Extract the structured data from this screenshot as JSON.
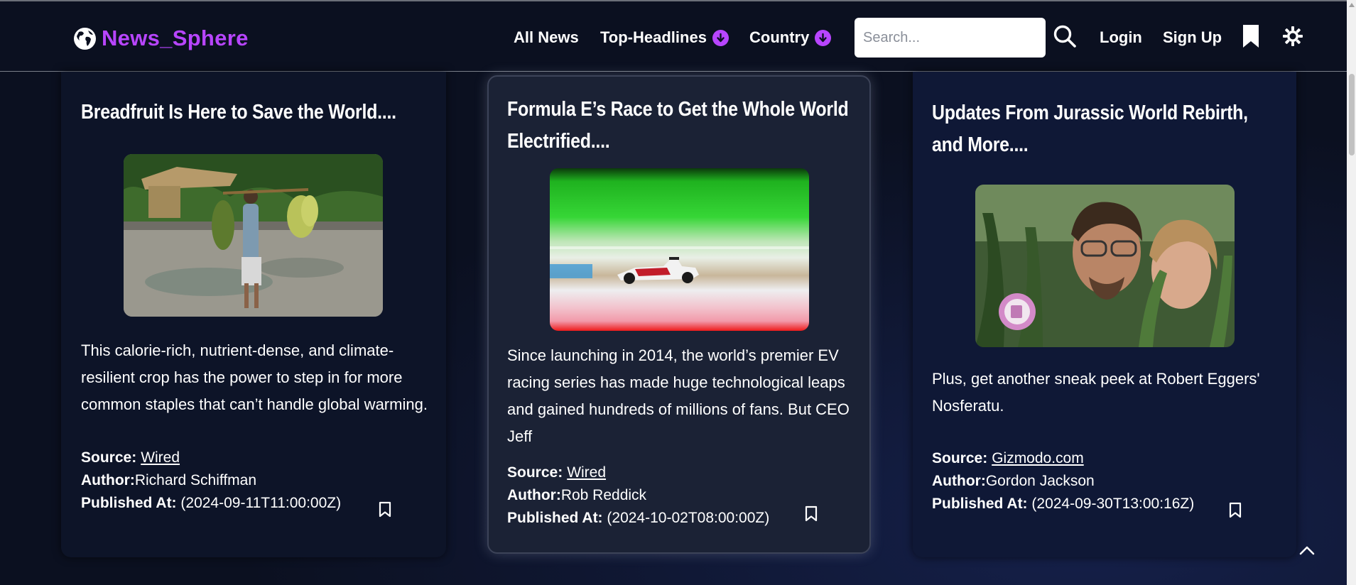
{
  "brand": {
    "name": "News_Sphere",
    "icon": "globe-icon",
    "color": "#b845ff"
  },
  "nav": {
    "all_news": "All News",
    "top_headlines": "Top-Headlines",
    "country": "Country",
    "login": "Login",
    "signup": "Sign Up"
  },
  "search": {
    "placeholder": "Search...",
    "value": ""
  },
  "labels": {
    "source": "Source:",
    "author": "Author:",
    "published": "Published At:"
  },
  "articles": [
    {
      "title": "Breadfruit Is Here to Save the World....",
      "description": "This calorie-rich, nutrient-dense, and climate-resilient crop has the power to step in for more common staples that can’t handle global warming.",
      "source": "Wired",
      "author": "Richard Schiffman",
      "published": "(2024-09-11T11:00:00Z)"
    },
    {
      "title": "Formula E’s Race to Get the Whole World Electrified....",
      "description": "Since launching in 2014, the world’s premier EV racing series has made huge technological leaps and gained hundreds of millions of fans. But CEO Jeff",
      "source": "Wired",
      "author": "Rob Reddick",
      "published": "(2024-10-02T08:00:00Z)"
    },
    {
      "title": "Updates From Jurassic World Rebirth, and More....",
      "description": "Plus, get another sneak peek at Robert Eggers' Nosferatu.",
      "source": "Gizmodo.com",
      "author": "Gordon Jackson",
      "published": "(2024-09-30T13:00:16Z)"
    }
  ]
}
